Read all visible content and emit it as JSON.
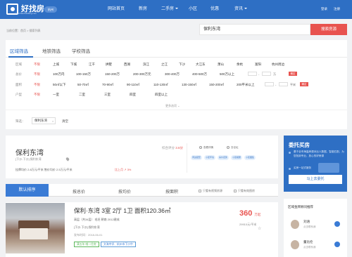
{
  "header": {
    "logo_text": "好找房",
    "logo_sub": "www.haozhaofang.com",
    "city": "杭州",
    "nav": [
      {
        "label": "网站首页",
        "dropdown": false
      },
      {
        "label": "新房",
        "dropdown": false
      },
      {
        "label": "二手房",
        "dropdown": true
      },
      {
        "label": "小区",
        "dropdown": false
      },
      {
        "label": "优惠",
        "dropdown": false
      },
      {
        "label": "资讯",
        "dropdown": true
      }
    ],
    "login": "登录",
    "register": "注册"
  },
  "breadcrumb": "当前位置：首页 > 搜索列表",
  "search": {
    "value": "保利东湾",
    "button": "搜索房源"
  },
  "tabs": [
    "区域筛选",
    "地铁筛选",
    "学校筛选"
  ],
  "filters": {
    "area": {
      "label": "区域",
      "options": [
        "不限",
        "上城",
        "下城",
        "江干",
        "拱墅",
        "西湖",
        "滨江",
        "之江",
        "下沙",
        "大江东",
        "萧山",
        "余杭",
        "富阳",
        "杭州周边"
      ]
    },
    "price": {
      "label": "总价",
      "options": [
        "不限",
        "100万内",
        "100-150万",
        "150-200万",
        "200-300万元",
        "300-400万",
        "400-500万",
        "500万以上"
      ],
      "unit": "万"
    },
    "size": {
      "label": "面积",
      "options": [
        "不限",
        "50㎡以下",
        "50-70㎡",
        "70-90㎡",
        "90-110㎡",
        "110-130㎡",
        "130-150㎡",
        "150-200㎡",
        "200平米以上"
      ],
      "unit": "平米"
    },
    "layout": {
      "label": "户型",
      "options": [
        "不限",
        "一室",
        "二室",
        "三室",
        "四室",
        "四室以上"
      ]
    },
    "confirm": "确定",
    "more": "更多选项"
  },
  "chosen": {
    "label": "筛选：",
    "tag": "保利东湾",
    "remove": "×",
    "clear": "清空"
  },
  "community": {
    "name": "保利东湾",
    "address": "[下沙-下沙] 保利东湾",
    "stats": "挂牌均价  2.8万元/平米    售价均价  2.5万元/平米",
    "trend": "比上月  ↗ 3%",
    "rating_label": "综合评分",
    "rating_value": "3.6分",
    "actions": [
      "查看详情",
      "去论坛"
    ],
    "tags": [
      "周边配套",
      "小区环境",
      "房价走势",
      "小区相册",
      "小区图集"
    ]
  },
  "sort": {
    "tabs": [
      "默认排序",
      "按总价",
      "按均价",
      "按面积"
    ],
    "checks": [
      "只看有视频房源",
      "只看有效图房"
    ]
  },
  "listing": {
    "title": "保利·东湾 3室 2厅 1卫 面积120.36㎡",
    "meta": "高层（共34层）   毛坯    朝南    2012建成",
    "location": "[下沙-下沙] 保利东湾",
    "date": "发布时间：2018-06-01",
    "tags": [
      {
        "label": "满五年 唯一住房",
        "color": "green"
      },
      {
        "label": "文海中学、杭州市下沙中",
        "color": "blue"
      }
    ],
    "price": "360",
    "price_unit": "万起",
    "unit_price": "29910元/平米",
    "fav": "☆"
  },
  "sidebar": {
    "promo_title": "委托买房",
    "promo_lines": [
      "基于全市海量房源对比人数据，智能匹配，为您找到专业、放心的好房源",
      "买房一站式服务"
    ],
    "promo_button": "马上去委托",
    "agents_title": "区域金牌顾问推荐",
    "agents": [
      {
        "name": "刘涵",
        "sub": "点击联系我"
      },
      {
        "name": "董比伦",
        "sub": "点击联系我"
      }
    ]
  }
}
